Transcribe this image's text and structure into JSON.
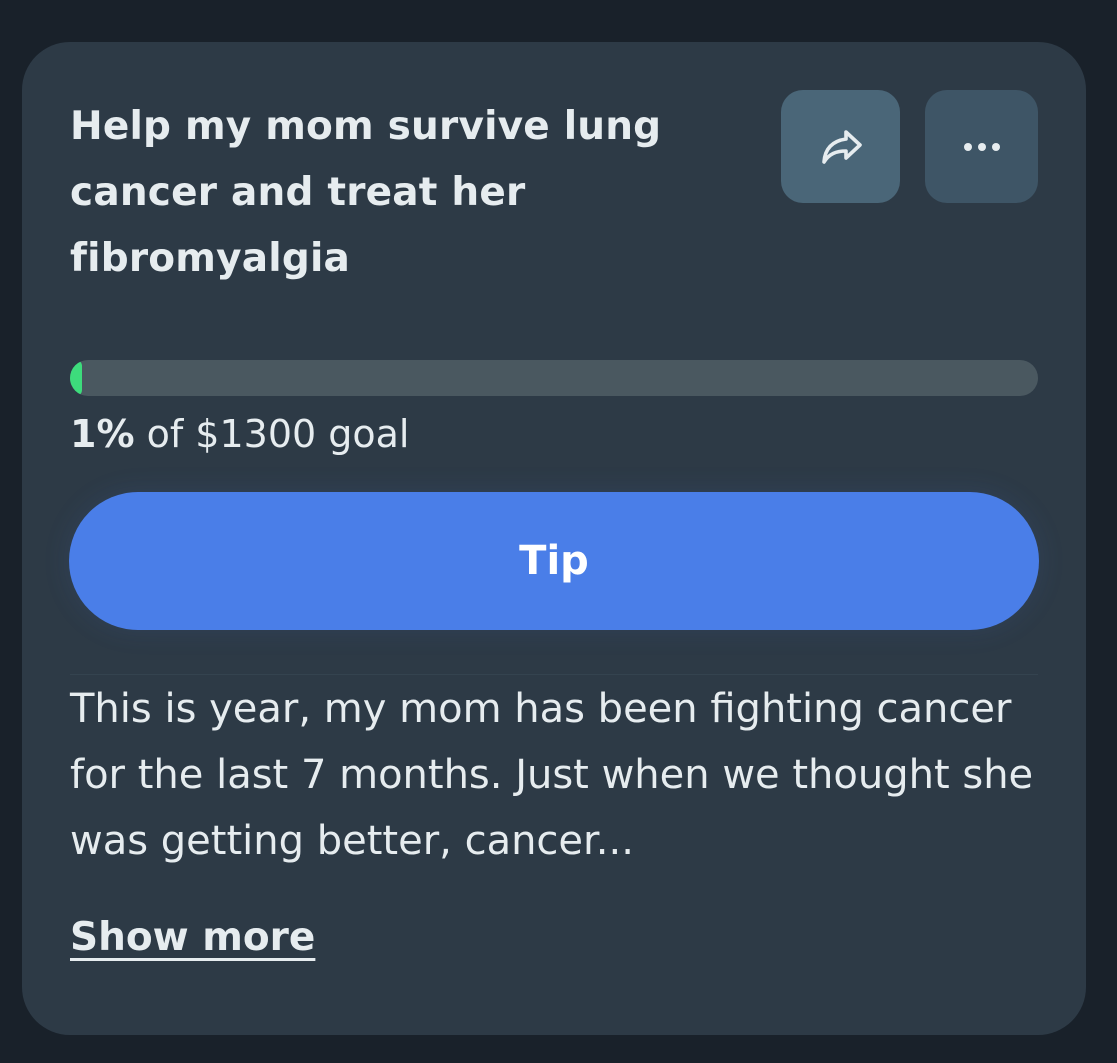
{
  "campaign": {
    "title": "Help my mom survive lung cancer and treat her fibromyalgia",
    "share_icon": "share-arrow-icon",
    "more_icon": "more-horizontal-icon",
    "progress_fraction": 0.01,
    "progress_color": "#3ddc7c",
    "goal_percent": "1%",
    "goal_suffix": " of $1300 goal",
    "tip_label": "Tip",
    "tip_color": "#4a7ee8",
    "description": "This is year, my mom has been fighting cancer for the last 7 months. Just when we thought she was getting better, cancer...",
    "show_more_label": "Show more"
  }
}
